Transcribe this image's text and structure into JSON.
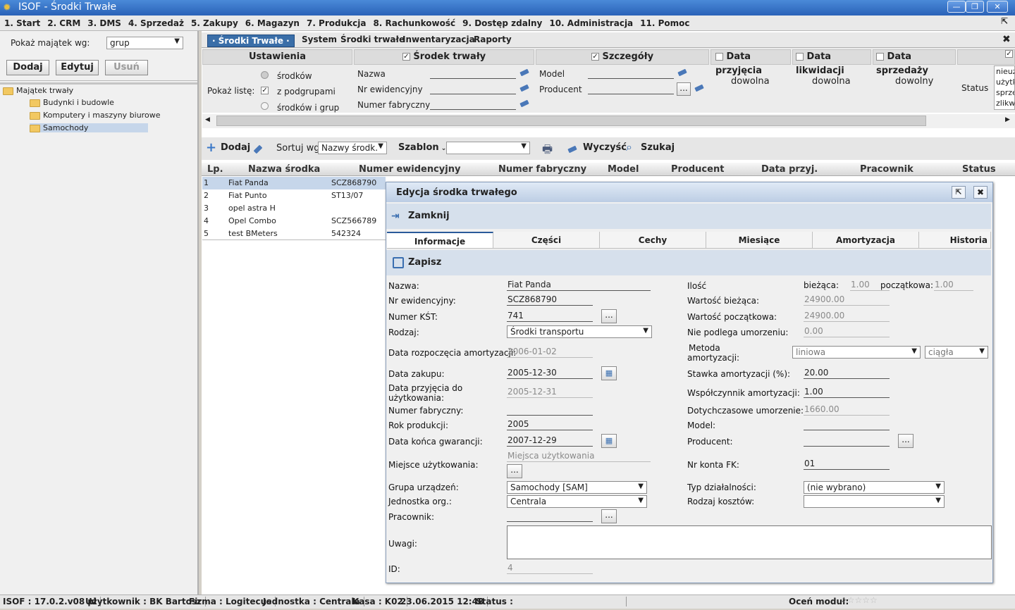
{
  "window": {
    "title": "ISOF - Środki Trwałe"
  },
  "menu": [
    "1. Start",
    "2. CRM",
    "3. DMS",
    "4. Sprzedaż",
    "5. Zakupy",
    "6. Magazyn",
    "7. Produkcja",
    "8. Rachunkowość",
    "9. Dostęp zdalny",
    "10. Administracja",
    "11. Pomoc"
  ],
  "left": {
    "show_label": "Pokaż majątek wg:",
    "show_value": "grup",
    "btn_add": "Dodaj",
    "btn_edit": "Edytuj",
    "btn_delete": "Usuń",
    "tree": [
      "Majątek trwały",
      "Budynki i budowle",
      "Komputery i maszyny biurowe",
      "Samochody"
    ]
  },
  "tabs": {
    "active": "· Środki Trwałe ·",
    "t1": "System",
    "t2": "Środki trwałe",
    "t3": "Inwentaryzacja",
    "t4": "Raporty"
  },
  "filter": {
    "settings": "Ustawienia",
    "fixed_asset": "Środek trwały",
    "details": "Szczegóły",
    "accept_date": "Data przyjęcia",
    "liq_date": "Data likwidacji",
    "sale_date": "Data sprzedaży",
    "show_list": "Pokaż listę:",
    "opt1": "środków",
    "opt2": "z podgrupami",
    "opt3": "środków i grup",
    "name": "Nazwa",
    "evid": "Nr ewidencyjny",
    "fab": "Numer fabryczny",
    "model": "Model",
    "producer": "Producent",
    "any1": "dowolna",
    "any2": "dowolna",
    "any3": "dowolny",
    "status": "Status",
    "status_list": [
      "nieuż",
      "użytk",
      "sprze",
      "zlikwi"
    ]
  },
  "toolbar": {
    "add": "Dodaj",
    "sort": "Sortuj wg:",
    "sort_value": "Nazwy środk.",
    "template": "Szablon",
    "clear": "Wyczyść",
    "search": "Szukaj"
  },
  "grid": {
    "headers": [
      "Lp.",
      "Nazwa środka",
      "Numer ewidencyjny",
      "Numer fabryczny",
      "Model",
      "Producent",
      "Data przyj.",
      "Pracownik",
      "Status"
    ],
    "rows": [
      [
        "1",
        "Fiat Panda",
        "SCZ868790"
      ],
      [
        "2",
        "Fiat Punto",
        "ST13/07"
      ],
      [
        "3",
        "opel astra H",
        ""
      ],
      [
        "4",
        "Opel Combo",
        "SCZ566789"
      ],
      [
        "5",
        "test BMeters",
        "542324"
      ]
    ]
  },
  "dialog": {
    "title": "Edycja środka trwałego",
    "close": "Zamknij",
    "tabs": [
      "Informacje",
      "Części",
      "Cechy",
      "Miesiące",
      "Amortyzacja",
      "Historia"
    ],
    "save": "Zapisz",
    "f": {
      "name_l": "Nazwa:",
      "name_v": "Fiat Panda",
      "evid_l": "Nr ewidencyjny:",
      "evid_v": "SCZ868790",
      "kst_l": "Numer KŚT:",
      "kst_v": "741",
      "type_l": "Rodzaj:",
      "type_v": "Środki transportu",
      "amstart_l": "Data rozpoczęcia amortyzacji:",
      "amstart_v": "2006-01-02",
      "buy_l": "Data zakupu:",
      "buy_v": "2005-12-30",
      "use_l1": "Data przyjęcia do",
      "use_l2": "użytkowania:",
      "use_v": "2005-12-31",
      "fab_l": "Numer fabryczny:",
      "year_l": "Rok produkcji:",
      "year_v": "2005",
      "warr_l": "Data końca gwarancji:",
      "warr_v": "2007-12-29",
      "place_l": "Miejsce użytkowania:",
      "place_ph": "Miejsca użytkowania",
      "group_l": "Grupa urządzeń:",
      "group_v": "Samochody [SAM]",
      "unit_l": "Jednostka org.:",
      "unit_v": "Centrala",
      "emp_l": "Pracownik:",
      "notes_l": "Uwagi:",
      "id_l": "ID:",
      "id_v": "4",
      "qty_l": "Ilość",
      "cur_l": "bieżąca:",
      "cur_v": "1.00",
      "init_l": "początkowa:",
      "init_v": "1.00",
      "vcur_l": "Wartość bieżąca:",
      "vcur_v": "24900.00",
      "vinit_l": "Wartość początkowa:",
      "vinit_v": "24900.00",
      "nodep_l": "Nie podlega umorzeniu:",
      "nodep_v": "0.00",
      "method_l1": "Metoda",
      "method_l2": "amortyzacji:",
      "method_v": "liniowa",
      "method_v2": "ciągła",
      "rate_l": "Stawka amortyzacji (%):",
      "rate_v": "20.00",
      "coef_l": "Współczynnik amortyzacji:",
      "coef_v": "1.00",
      "sofar_l": "Dotychczasowe umorzenie:",
      "sofar_v": "1660.00",
      "model_l": "Model:",
      "prod_l": "Producent:",
      "acct_l": "Nr konta FK:",
      "acct_v": "01",
      "activity_l": "Typ działalności:",
      "activity_v": "(nie wybrano)",
      "cost_l": "Rodzaj kosztów:"
    }
  },
  "statusbar": {
    "version": "ISOF : 17.0.2.v08 pl",
    "user": "Użytkownik : BK Bartosz",
    "company": "Firma : Logitecus",
    "unit": "Jednostka : Centrala",
    "till": "Kasa : K02",
    "datetime": "23.06.2015 12:48",
    "status": "Status :",
    "rate": "Oceń moduł:"
  },
  "colors": {
    "accent": "#2a62b8",
    "selected": "#c6d6ea",
    "dialog_band": "#d6e0ec"
  }
}
